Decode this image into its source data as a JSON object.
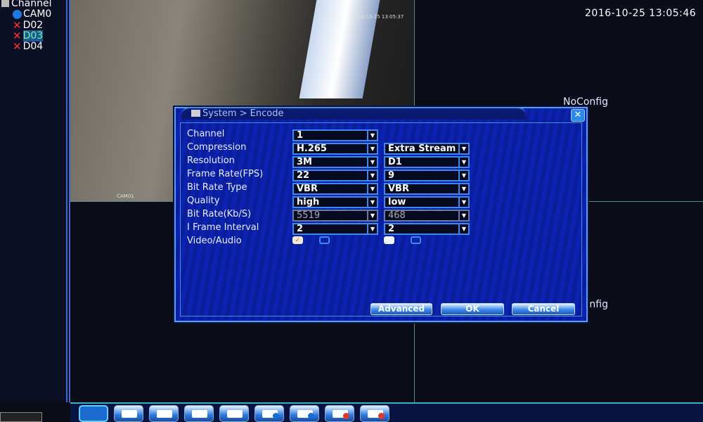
{
  "sidebar": {
    "title": "Channel",
    "channels": [
      {
        "label": "CAM0",
        "status": "playing",
        "icon": "play-icon"
      },
      {
        "label": "D02",
        "status": "disconnected",
        "icon": "x-icon"
      },
      {
        "label": "D03",
        "status": "disconnected",
        "icon": "x-icon",
        "selected": true
      },
      {
        "label": "D04",
        "status": "disconnected",
        "icon": "x-icon"
      }
    ]
  },
  "video": {
    "osd_time": "2016-10-25 13:05:37",
    "camera_label": "CAM01"
  },
  "clock": "2016-10-25 13:05:46",
  "noconfig": [
    "NoConfig",
    "NoConfig"
  ],
  "dialog": {
    "title": "System > Encode",
    "rows": [
      {
        "label": "Channel",
        "main": "1"
      },
      {
        "label": "Compression",
        "main": "H.265",
        "extra": "Extra Stream"
      },
      {
        "label": "Resolution",
        "main": "3M",
        "extra": "D1"
      },
      {
        "label": "Frame Rate(FPS)",
        "main": "22",
        "extra": "9"
      },
      {
        "label": "Bit Rate Type",
        "main": "VBR",
        "extra": "VBR"
      },
      {
        "label": "Quality",
        "main": "high",
        "extra": "low"
      },
      {
        "label": "Bit Rate(Kb/S)",
        "main": "5519",
        "extra": "468"
      },
      {
        "label": "I Frame Interval",
        "main": "2",
        "extra": "2"
      },
      {
        "label": "Video/Audio",
        "main_video": true,
        "main_audio": false,
        "extra_video": true,
        "extra_audio": false
      }
    ],
    "buttons": {
      "advanced": "Advanced",
      "ok": "OK",
      "cancel": "Cancel"
    }
  },
  "toolbar": [
    "single-view",
    "quad-view",
    "fullscreen",
    "previous",
    "next",
    "playback",
    "playback-2",
    "record",
    "stop-record"
  ],
  "colors": {
    "dialog_bg": "#0c22b0",
    "border": "#3a8af0",
    "disconnected": "#ff3030"
  }
}
